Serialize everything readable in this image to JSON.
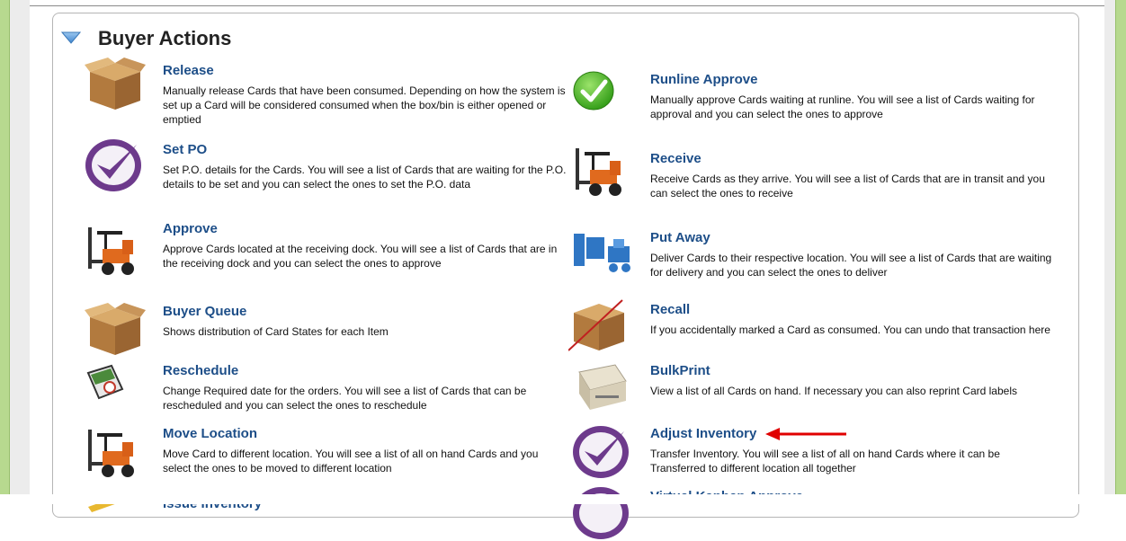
{
  "section": {
    "title": "Buyer Actions"
  },
  "left_actions": [
    {
      "name": "Release",
      "desc": "Manually release Cards that have been consumed. Depending on how the system is set up a Card will be considered consumed when the box/bin is either opened or emptied",
      "icon": "cardboard-box-icon"
    },
    {
      "name": "Set PO",
      "desc": "Set P.O. details for the Cards. You will see a list of Cards that are waiting for the P.O. details to be set and you can select the ones to set the P.O. data",
      "icon": "purple-checkmark-icon"
    },
    {
      "name": "Approve",
      "desc": "Approve Cards located at the receiving dock. You will see a list of Cards that are in the receiving dock and you can select the ones to approve",
      "icon": "forklift-icon"
    },
    {
      "name": "Buyer Queue",
      "desc": "Shows distribution of Card States for each Item",
      "icon": "cardboard-box-icon"
    },
    {
      "name": "Reschedule",
      "desc": "Change Required date for the orders. You will see a list of Cards that can be rescheduled and you can select the ones to reschedule",
      "icon": "calendar-clock-icon"
    },
    {
      "name": "Move Location",
      "desc": "Move Card to different location. You will see a list of all on hand Cards and you select the ones to be moved to different location",
      "icon": "forklift-icon"
    },
    {
      "name": "Issue Inventory",
      "desc": "",
      "icon": "pencil-icon"
    }
  ],
  "right_actions": [
    {
      "name": "Runline Approve",
      "desc": "Manually approve Cards waiting at runline. You will see a list of Cards waiting for approval and you can select the ones to approve",
      "icon": "green-check-circle-icon"
    },
    {
      "name": "Receive",
      "desc": "Receive Cards as they arrive. You will see a list of Cards that are in transit and you can select the ones to receive",
      "icon": "forklift-icon"
    },
    {
      "name": "Put Away",
      "desc": "Deliver Cards to their respective location. You will see a list of Cards that are waiting for delivery and you can select the ones to deliver",
      "icon": "blue-forklift-icon"
    },
    {
      "name": "Recall",
      "desc": "If you accidentally marked a Card as consumed. You can undo that transaction here",
      "icon": "crossed-box-icon"
    },
    {
      "name": "BulkPrint",
      "desc": "View a list of all Cards on hand. If necessary you can also reprint Card labels",
      "icon": "printer-icon"
    },
    {
      "name": "Adjust Inventory",
      "desc": "Transfer Inventory. You will see a list of all on hand Cards where it can be Transferred to different location all together",
      "icon": "purple-checkmark-icon"
    },
    {
      "name": "Virtual Kanban Approve",
      "desc": "",
      "icon": "purple-checkmark-icon"
    }
  ],
  "colors": {
    "link": "#1d4e88",
    "frame_green": "#b7d98f",
    "arrow_red": "#e00000"
  }
}
